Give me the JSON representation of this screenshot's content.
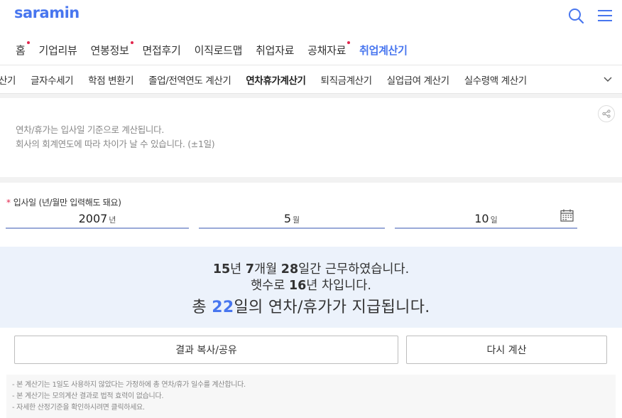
{
  "header": {
    "logo": "saramin",
    "search_icon": "search-icon",
    "menu_icon": "hamburger-menu-icon"
  },
  "gnb": [
    {
      "label": "홈",
      "dot": true
    },
    {
      "label": "기업리뷰",
      "dot": false
    },
    {
      "label": "연봉정보",
      "dot": true
    },
    {
      "label": "면접후기",
      "dot": false
    },
    {
      "label": "이직로드맵",
      "dot": false
    },
    {
      "label": "취업자료",
      "dot": false
    },
    {
      "label": "공채자료",
      "dot": true
    },
    {
      "label": "취업계산기",
      "dot": false,
      "active": true
    }
  ],
  "subnav": {
    "items": [
      "계산기",
      "글자수세기",
      "학점 변환기",
      "졸업/전역연도 계산기",
      "연차휴가계산기",
      "퇴직금계산기",
      "실업급여 계산기",
      "실수령액 계산기"
    ],
    "active_index": 4,
    "more_icon": "chevron-down-icon"
  },
  "notice": {
    "line1": "연차/휴가는 입사일 기준으로 계산됩니다.",
    "line2": "회사의 회계연도에 따라 차이가 날 수 있습니다. (±1일)",
    "share_icon": "share-icon"
  },
  "form": {
    "required_mark": "*",
    "label": "입사일 (년/월만 입력해도 돼요)",
    "year": {
      "value": "2007",
      "unit": "년"
    },
    "month": {
      "value": "5",
      "unit": "월"
    },
    "day": {
      "value": "10",
      "unit": "일"
    },
    "calendar_icon": "calendar-icon"
  },
  "result": {
    "years": "15",
    "years_unit": "년 ",
    "months": "7",
    "months_unit": "개월 ",
    "days": "28",
    "days_tail": "일간 근무하였습니다.",
    "service_pre": "햇수로 ",
    "service_years": "16",
    "service_tail": "년 차입니다.",
    "total_pre": "총 ",
    "total_days": "22",
    "total_tail": "일의 연차/휴가가 지급됩니다."
  },
  "buttons": {
    "copy": "결과 복사/공유",
    "reset": "다시 계산"
  },
  "footnotes": [
    "- 본 계산기는 1일도 사용하지 않았다는 가정하에 총 연차/휴가 일수를 계산합니다.",
    "- 본 계산기는 모의계산 결과로 법적 효력이 없습니다.",
    "- 자세한 산정기준을 확인하시려면 클릭하세요."
  ]
}
